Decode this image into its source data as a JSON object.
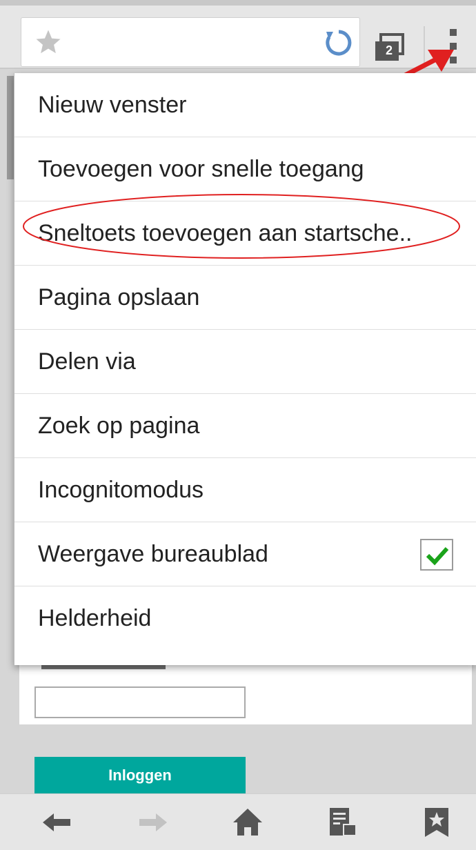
{
  "toolbar": {
    "tab_count": "2",
    "icons": [
      "star-icon",
      "reload-icon",
      "tabs-icon",
      "overflow-menu-icon"
    ]
  },
  "menu": {
    "items": [
      {
        "label": "Nieuw venster"
      },
      {
        "label": "Toevoegen voor snelle toegang"
      },
      {
        "label": "Sneltoets toevoegen aan startsche.."
      },
      {
        "label": "Pagina opslaan"
      },
      {
        "label": "Delen via"
      },
      {
        "label": "Zoek op pagina"
      },
      {
        "label": "Incognitomodus"
      },
      {
        "label": "Weergave bureaublad",
        "checked": true
      },
      {
        "label": "Helderheid"
      }
    ],
    "highlighted_index": 2
  },
  "page": {
    "login_button": "Inloggen"
  },
  "bottom_nav": {
    "icons": [
      "back-arrow-icon",
      "forward-arrow-icon",
      "home-icon",
      "reader-mode-icon",
      "bookmark-icon"
    ]
  },
  "colors": {
    "accent_red": "#e02020",
    "check_green": "#1aa31a",
    "login_teal": "#00a79d"
  }
}
